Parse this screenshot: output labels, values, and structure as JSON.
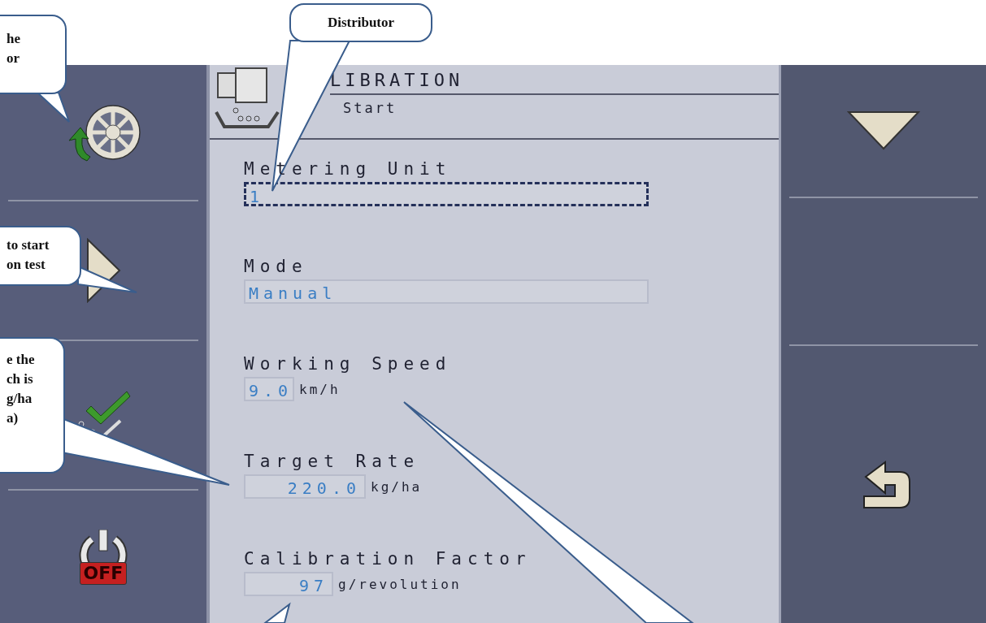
{
  "callouts": [
    {
      "lines": [
        "he",
        "or"
      ]
    },
    {
      "lines": [
        "Distributor"
      ]
    },
    {
      "lines": [
        "to start",
        "on test"
      ]
    },
    {
      "lines": [
        "e the",
        "ch is",
        "g/ha",
        "a)"
      ]
    }
  ],
  "header": {
    "title": "LIBRATION",
    "subtitle": "Start"
  },
  "fields": [
    {
      "kind": "text",
      "label": "Metering Unit",
      "value": "1",
      "focused": true
    },
    {
      "kind": "text",
      "label": "Mode",
      "value": "Manual",
      "focused": false
    },
    {
      "kind": "number",
      "label": "Working Speed",
      "value": "9.0",
      "unit": "km/h",
      "focused": false
    },
    {
      "kind": "number",
      "label": "Target Rate",
      "value": "220.0",
      "unit": "kg/ha",
      "focused": false
    },
    {
      "kind": "number",
      "label": "Calibration Factor",
      "value": "97",
      "unit": "g/revolution",
      "focused": false
    }
  ],
  "power_key": {
    "badge": "OFF"
  }
}
